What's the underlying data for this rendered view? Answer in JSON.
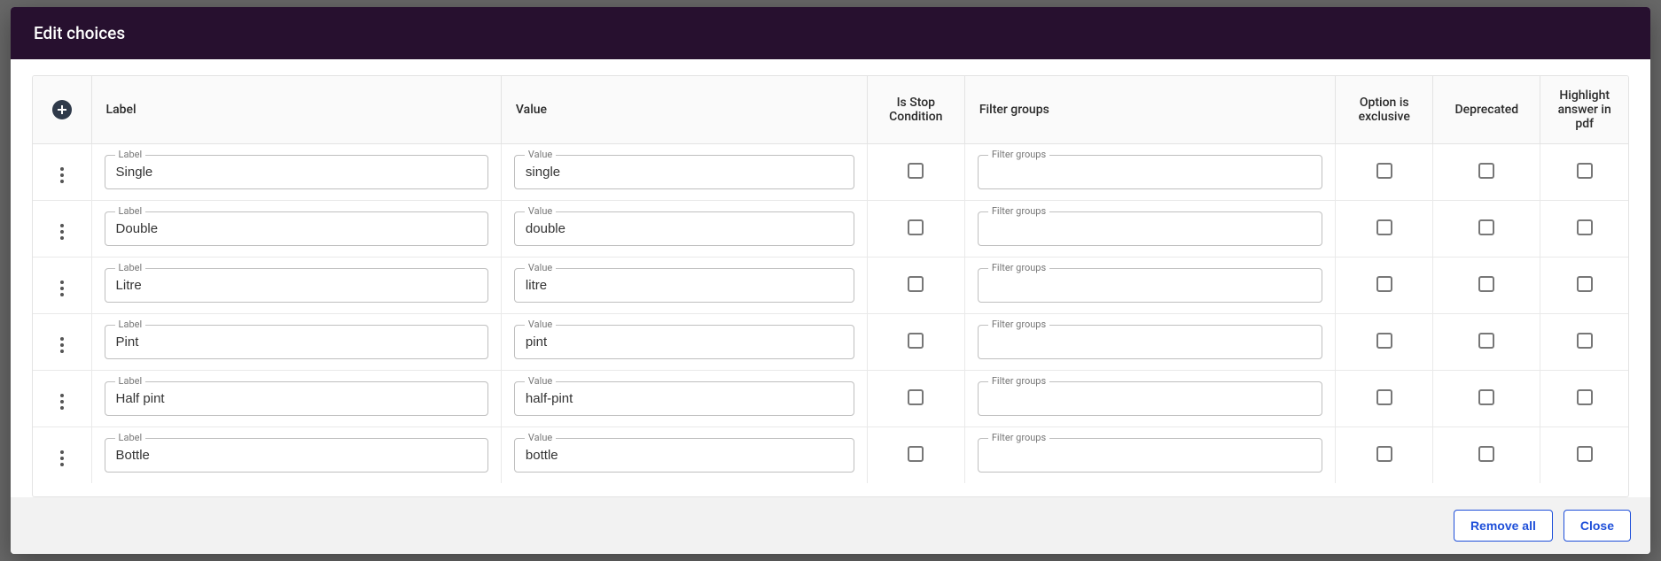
{
  "dialog": {
    "title": "Edit choices"
  },
  "columns": {
    "label": "Label",
    "value": "Value",
    "is_stop": "Is Stop Condition",
    "filter_groups": "Filter groups",
    "exclusive": "Option is exclusive",
    "deprecated": "Deprecated",
    "highlight": "Highlight answer in pdf"
  },
  "field_legends": {
    "label": "Label",
    "value": "Value",
    "filter_groups": "Filter groups"
  },
  "rows": [
    {
      "label": "Single",
      "value": "single",
      "filter_groups": "",
      "is_stop": false,
      "exclusive": false,
      "deprecated": false,
      "highlight": false
    },
    {
      "label": "Double",
      "value": "double",
      "filter_groups": "",
      "is_stop": false,
      "exclusive": false,
      "deprecated": false,
      "highlight": false
    },
    {
      "label": "Litre",
      "value": "litre",
      "filter_groups": "",
      "is_stop": false,
      "exclusive": false,
      "deprecated": false,
      "highlight": false
    },
    {
      "label": "Pint",
      "value": "pint",
      "filter_groups": "",
      "is_stop": false,
      "exclusive": false,
      "deprecated": false,
      "highlight": false
    },
    {
      "label": "Half pint",
      "value": "half-pint",
      "filter_groups": "",
      "is_stop": false,
      "exclusive": false,
      "deprecated": false,
      "highlight": false
    },
    {
      "label": "Bottle",
      "value": "bottle",
      "filter_groups": "",
      "is_stop": false,
      "exclusive": false,
      "deprecated": false,
      "highlight": false
    }
  ],
  "footer": {
    "remove_all": "Remove all",
    "close": "Close"
  }
}
